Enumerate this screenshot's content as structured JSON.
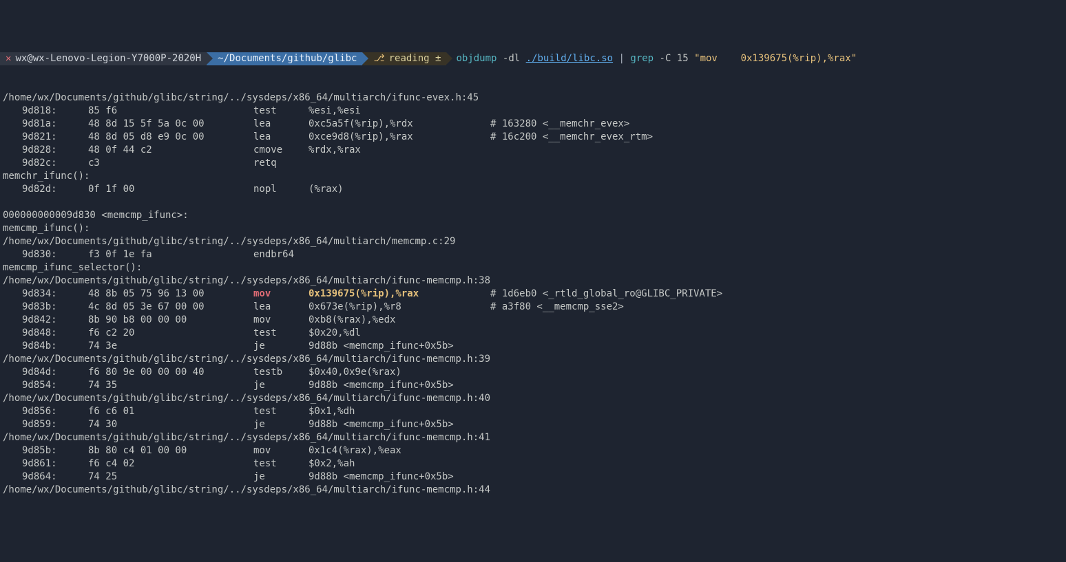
{
  "prompt": {
    "close": "✕",
    "host": "wx@wx-Lenovo-Legion-Y7000P-2020H",
    "path": "~/Documents/github/glibc",
    "branch_icon": "⎇",
    "branch": "reading ±",
    "cmd1": "objdump",
    "flag1": "-dl",
    "arg1": "./build/libc.so",
    "pipe": "|",
    "cmd2": "grep",
    "flag2": "-C 15",
    "str": "\"mov    0x139675(%rip),%rax\""
  },
  "lines": [
    {
      "t": "src",
      "v": "/home/wx/Documents/github/glibc/string/../sysdeps/x86_64/multiarch/ifunc-evex.h:45"
    },
    {
      "t": "asm",
      "addr": "9d818:",
      "hex": "85 f6",
      "mnem": "test",
      "op": "%esi,%esi",
      "com": ""
    },
    {
      "t": "asm",
      "addr": "9d81a:",
      "hex": "48 8d 15 5f 5a 0c 00",
      "mnem": "lea",
      "op": "0xc5a5f(%rip),%rdx",
      "com": "# 163280 <__memchr_evex>"
    },
    {
      "t": "asm",
      "addr": "9d821:",
      "hex": "48 8d 05 d8 e9 0c 00",
      "mnem": "lea",
      "op": "0xce9d8(%rip),%rax",
      "com": "# 16c200 <__memchr_evex_rtm>"
    },
    {
      "t": "asm",
      "addr": "9d828:",
      "hex": "48 0f 44 c2",
      "mnem": "cmove",
      "op": "%rdx,%rax",
      "com": ""
    },
    {
      "t": "asm",
      "addr": "9d82c:",
      "hex": "c3",
      "mnem": "retq",
      "op": "",
      "com": ""
    },
    {
      "t": "src",
      "v": "memchr_ifunc():"
    },
    {
      "t": "asm",
      "addr": "9d82d:",
      "hex": "0f 1f 00",
      "mnem": "nopl",
      "op": "(%rax)",
      "com": ""
    },
    {
      "t": "blank",
      "v": ""
    },
    {
      "t": "src",
      "v": "000000000009d830 <memcmp_ifunc>:"
    },
    {
      "t": "src",
      "v": "memcmp_ifunc():"
    },
    {
      "t": "src",
      "v": "/home/wx/Documents/github/glibc/string/../sysdeps/x86_64/multiarch/memcmp.c:29"
    },
    {
      "t": "asm",
      "addr": "9d830:",
      "hex": "f3 0f 1e fa",
      "mnem": "endbr64",
      "op": "",
      "com": ""
    },
    {
      "t": "src",
      "v": "memcmp_ifunc_selector():"
    },
    {
      "t": "src",
      "v": "/home/wx/Documents/github/glibc/string/../sysdeps/x86_64/multiarch/ifunc-memcmp.h:38"
    },
    {
      "t": "asm-hl",
      "addr": "9d834:",
      "hex": "48 8b 05 75 96 13 00",
      "mnem": "mov",
      "op": "0x139675(%rip),%rax",
      "com": "# 1d6eb0 <_rtld_global_ro@GLIBC_PRIVATE>"
    },
    {
      "t": "asm",
      "addr": "9d83b:",
      "hex": "4c 8d 05 3e 67 00 00",
      "mnem": "lea",
      "op": "0x673e(%rip),%r8",
      "com": "# a3f80 <__memcmp_sse2>"
    },
    {
      "t": "asm",
      "addr": "9d842:",
      "hex": "8b 90 b8 00 00 00",
      "mnem": "mov",
      "op": "0xb8(%rax),%edx",
      "com": ""
    },
    {
      "t": "asm",
      "addr": "9d848:",
      "hex": "f6 c2 20",
      "mnem": "test",
      "op": "$0x20,%dl",
      "com": ""
    },
    {
      "t": "asm",
      "addr": "9d84b:",
      "hex": "74 3e",
      "mnem": "je",
      "op": "9d88b <memcmp_ifunc+0x5b>",
      "com": ""
    },
    {
      "t": "src",
      "v": "/home/wx/Documents/github/glibc/string/../sysdeps/x86_64/multiarch/ifunc-memcmp.h:39"
    },
    {
      "t": "asm",
      "addr": "9d84d:",
      "hex": "f6 80 9e 00 00 00 40",
      "mnem": "testb",
      "op": "$0x40,0x9e(%rax)",
      "com": ""
    },
    {
      "t": "asm",
      "addr": "9d854:",
      "hex": "74 35",
      "mnem": "je",
      "op": "9d88b <memcmp_ifunc+0x5b>",
      "com": ""
    },
    {
      "t": "src",
      "v": "/home/wx/Documents/github/glibc/string/../sysdeps/x86_64/multiarch/ifunc-memcmp.h:40"
    },
    {
      "t": "asm",
      "addr": "9d856:",
      "hex": "f6 c6 01",
      "mnem": "test",
      "op": "$0x1,%dh",
      "com": ""
    },
    {
      "t": "asm",
      "addr": "9d859:",
      "hex": "74 30",
      "mnem": "je",
      "op": "9d88b <memcmp_ifunc+0x5b>",
      "com": ""
    },
    {
      "t": "src",
      "v": "/home/wx/Documents/github/glibc/string/../sysdeps/x86_64/multiarch/ifunc-memcmp.h:41"
    },
    {
      "t": "asm",
      "addr": "9d85b:",
      "hex": "8b 80 c4 01 00 00",
      "mnem": "mov",
      "op": "0x1c4(%rax),%eax",
      "com": ""
    },
    {
      "t": "asm",
      "addr": "9d861:",
      "hex": "f6 c4 02",
      "mnem": "test",
      "op": "$0x2,%ah",
      "com": ""
    },
    {
      "t": "asm",
      "addr": "9d864:",
      "hex": "74 25",
      "mnem": "je",
      "op": "9d88b <memcmp_ifunc+0x5b>",
      "com": ""
    },
    {
      "t": "src",
      "v": "/home/wx/Documents/github/glibc/string/../sysdeps/x86_64/multiarch/ifunc-memcmp.h:44"
    }
  ]
}
